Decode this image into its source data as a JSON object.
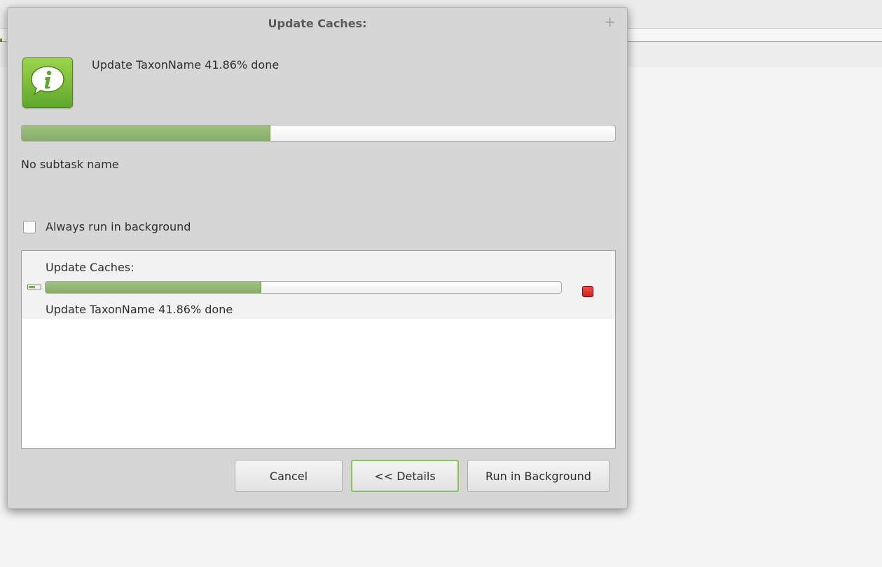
{
  "dialog": {
    "title": "Update Caches:",
    "title_action": "+",
    "message": "Update TaxonName 41.86% done",
    "progress_percent": 41.86,
    "subtask": "No subtask name",
    "checkbox": {
      "label": "Always run in background",
      "checked": false
    },
    "job": {
      "title": "Update Caches:",
      "status": "Update TaxonName 41.86% done",
      "progress_percent": 41.86
    },
    "buttons": {
      "cancel": "Cancel",
      "details": "<< Details",
      "background": "Run in Background"
    }
  },
  "icons": {
    "main": "info-icon",
    "job": "progress-job-icon",
    "stop": "stop-icon"
  },
  "colors": {
    "progress_fill": "#8fb672",
    "info_icon": "#6cb535",
    "stop": "#e03131",
    "focus_border": "#8dbf67"
  }
}
